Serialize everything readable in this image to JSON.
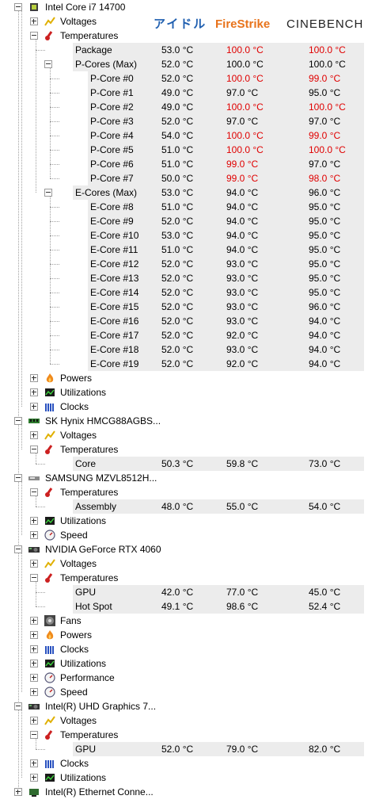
{
  "header": {
    "col1": "アイドル",
    "col2": "FireStrike",
    "col3": "CINEBENCH"
  },
  "colors": {
    "red": "#e00000",
    "idle": "#1f5fb0",
    "firestrike": "#e8731b"
  },
  "rows": [
    {
      "label": "Intel Core i7 14700",
      "level": 0,
      "exp": "minus",
      "icon": "cpu-icon"
    },
    {
      "label": "Voltages",
      "level": 1,
      "exp": "plus",
      "icon": "voltage-icon"
    },
    {
      "label": "Temperatures",
      "level": 1,
      "exp": "minus",
      "icon": "thermometer-icon"
    },
    {
      "label": "Package",
      "level": 2,
      "v": [
        "53.0 °C",
        "100.0 °C",
        "100.0 °C"
      ],
      "r": [
        0,
        1,
        1
      ]
    },
    {
      "label": "P-Cores (Max)",
      "level": 2,
      "exp": "minus",
      "v": [
        "52.0 °C",
        "100.0 °C",
        "100.0 °C"
      ],
      "r": [
        0,
        0,
        0
      ]
    },
    {
      "label": "P-Core #0",
      "level": 3,
      "v": [
        "52.0 °C",
        "100.0 °C",
        "99.0 °C"
      ],
      "r": [
        0,
        1,
        1
      ]
    },
    {
      "label": "P-Core #1",
      "level": 3,
      "v": [
        "49.0 °C",
        "97.0 °C",
        "95.0 °C"
      ],
      "r": [
        0,
        0,
        0
      ]
    },
    {
      "label": "P-Core #2",
      "level": 3,
      "v": [
        "49.0 °C",
        "100.0 °C",
        "100.0 °C"
      ],
      "r": [
        0,
        1,
        1
      ]
    },
    {
      "label": "P-Core #3",
      "level": 3,
      "v": [
        "52.0 °C",
        "97.0 °C",
        "97.0 °C"
      ],
      "r": [
        0,
        0,
        0
      ]
    },
    {
      "label": "P-Core #4",
      "level": 3,
      "v": [
        "54.0 °C",
        "100.0 °C",
        "99.0 °C"
      ],
      "r": [
        0,
        1,
        1
      ]
    },
    {
      "label": "P-Core #5",
      "level": 3,
      "v": [
        "51.0 °C",
        "100.0 °C",
        "100.0 °C"
      ],
      "r": [
        0,
        1,
        1
      ]
    },
    {
      "label": "P-Core #6",
      "level": 3,
      "v": [
        "51.0 °C",
        "99.0 °C",
        "97.0 °C"
      ],
      "r": [
        0,
        1,
        0
      ]
    },
    {
      "label": "P-Core #7",
      "level": 3,
      "v": [
        "50.0 °C",
        "99.0 °C",
        "98.0 °C"
      ],
      "r": [
        0,
        1,
        1
      ]
    },
    {
      "label": "E-Cores (Max)",
      "level": 2,
      "exp": "minus",
      "v": [
        "53.0 °C",
        "94.0 °C",
        "96.0 °C"
      ],
      "r": [
        0,
        0,
        0
      ]
    },
    {
      "label": "E-Core #8",
      "level": 3,
      "v": [
        "51.0 °C",
        "94.0 °C",
        "95.0 °C"
      ],
      "r": [
        0,
        0,
        0
      ]
    },
    {
      "label": "E-Core #9",
      "level": 3,
      "v": [
        "52.0 °C",
        "94.0 °C",
        "95.0 °C"
      ],
      "r": [
        0,
        0,
        0
      ]
    },
    {
      "label": "E-Core #10",
      "level": 3,
      "v": [
        "53.0 °C",
        "94.0 °C",
        "95.0 °C"
      ],
      "r": [
        0,
        0,
        0
      ]
    },
    {
      "label": "E-Core #11",
      "level": 3,
      "v": [
        "51.0 °C",
        "94.0 °C",
        "95.0 °C"
      ],
      "r": [
        0,
        0,
        0
      ]
    },
    {
      "label": "E-Core #12",
      "level": 3,
      "v": [
        "52.0 °C",
        "93.0 °C",
        "95.0 °C"
      ],
      "r": [
        0,
        0,
        0
      ]
    },
    {
      "label": "E-Core #13",
      "level": 3,
      "v": [
        "52.0 °C",
        "93.0 °C",
        "95.0 °C"
      ],
      "r": [
        0,
        0,
        0
      ]
    },
    {
      "label": "E-Core #14",
      "level": 3,
      "v": [
        "52.0 °C",
        "93.0 °C",
        "95.0 °C"
      ],
      "r": [
        0,
        0,
        0
      ]
    },
    {
      "label": "E-Core #15",
      "level": 3,
      "v": [
        "52.0 °C",
        "93.0 °C",
        "96.0 °C"
      ],
      "r": [
        0,
        0,
        0
      ]
    },
    {
      "label": "E-Core #16",
      "level": 3,
      "v": [
        "52.0 °C",
        "93.0 °C",
        "94.0 °C"
      ],
      "r": [
        0,
        0,
        0
      ]
    },
    {
      "label": "E-Core #17",
      "level": 3,
      "v": [
        "52.0 °C",
        "92.0 °C",
        "94.0 °C"
      ],
      "r": [
        0,
        0,
        0
      ]
    },
    {
      "label": "E-Core #18",
      "level": 3,
      "v": [
        "52.0 °C",
        "93.0 °C",
        "94.0 °C"
      ],
      "r": [
        0,
        0,
        0
      ]
    },
    {
      "label": "E-Core #19",
      "level": 3,
      "v": [
        "52.0 °C",
        "92.0 °C",
        "94.0 °C"
      ],
      "r": [
        0,
        0,
        0
      ]
    },
    {
      "label": "Powers",
      "level": 1,
      "exp": "plus",
      "icon": "power-icon"
    },
    {
      "label": "Utilizations",
      "level": 1,
      "exp": "plus",
      "icon": "utilization-icon"
    },
    {
      "label": "Clocks",
      "level": 1,
      "exp": "plus",
      "icon": "clock-bars-icon"
    },
    {
      "label": "SK Hynix HMCG88AGBS...",
      "level": 0,
      "exp": "minus",
      "icon": "memory-icon"
    },
    {
      "label": "Voltages",
      "level": 1,
      "exp": "plus",
      "icon": "voltage-icon"
    },
    {
      "label": "Temperatures",
      "level": 1,
      "exp": "minus",
      "icon": "thermometer-icon"
    },
    {
      "label": "Core",
      "level": 2,
      "v": [
        "50.3 °C",
        "59.8 °C",
        "73.0 °C"
      ],
      "r": [
        0,
        0,
        0
      ]
    },
    {
      "label": "SAMSUNG MZVL8512H...",
      "level": 0,
      "exp": "minus",
      "icon": "drive-icon"
    },
    {
      "label": "Temperatures",
      "level": 1,
      "exp": "minus",
      "icon": "thermometer-icon"
    },
    {
      "label": "Assembly",
      "level": 2,
      "v": [
        "48.0 °C",
        "55.0 °C",
        "54.0 °C"
      ],
      "r": [
        0,
        0,
        0
      ]
    },
    {
      "label": "Utilizations",
      "level": 1,
      "exp": "plus",
      "icon": "utilization-icon"
    },
    {
      "label": "Speed",
      "level": 1,
      "exp": "plus",
      "icon": "speed-icon"
    },
    {
      "label": "NVIDIA GeForce RTX 4060",
      "level": 0,
      "exp": "minus",
      "icon": "gpu-icon"
    },
    {
      "label": "Voltages",
      "level": 1,
      "exp": "plus",
      "icon": "voltage-icon"
    },
    {
      "label": "Temperatures",
      "level": 1,
      "exp": "minus",
      "icon": "thermometer-icon"
    },
    {
      "label": "GPU",
      "level": 2,
      "v": [
        "42.0 °C",
        "77.0 °C",
        "45.0 °C"
      ],
      "r": [
        0,
        0,
        0
      ]
    },
    {
      "label": "Hot Spot",
      "level": 2,
      "v": [
        "49.1 °C",
        "98.6 °C",
        "52.4 °C"
      ],
      "r": [
        0,
        0,
        0
      ]
    },
    {
      "label": "Fans",
      "level": 1,
      "exp": "plus",
      "icon": "fan-icon"
    },
    {
      "label": "Powers",
      "level": 1,
      "exp": "plus",
      "icon": "power-icon"
    },
    {
      "label": "Clocks",
      "level": 1,
      "exp": "plus",
      "icon": "clock-bars-icon"
    },
    {
      "label": "Utilizations",
      "level": 1,
      "exp": "plus",
      "icon": "utilization-icon"
    },
    {
      "label": "Performance",
      "level": 1,
      "exp": "plus",
      "icon": "speed-icon"
    },
    {
      "label": "Speed",
      "level": 1,
      "exp": "plus",
      "icon": "speed-icon"
    },
    {
      "label": "Intel(R) UHD Graphics 7...",
      "level": 0,
      "exp": "minus",
      "icon": "gpu-icon"
    },
    {
      "label": "Voltages",
      "level": 1,
      "exp": "plus",
      "icon": "voltage-icon"
    },
    {
      "label": "Temperatures",
      "level": 1,
      "exp": "minus",
      "icon": "thermometer-icon"
    },
    {
      "label": "GPU",
      "level": 2,
      "v": [
        "52.0 °C",
        "79.0 °C",
        "82.0 °C"
      ],
      "r": [
        0,
        0,
        0
      ]
    },
    {
      "label": "Clocks",
      "level": 1,
      "exp": "plus",
      "icon": "clock-bars-icon"
    },
    {
      "label": "Utilizations",
      "level": 1,
      "exp": "plus",
      "icon": "utilization-icon"
    },
    {
      "label": "Intel(R) Ethernet Conne...",
      "level": 0,
      "exp": "plus",
      "icon": "network-icon"
    }
  ]
}
